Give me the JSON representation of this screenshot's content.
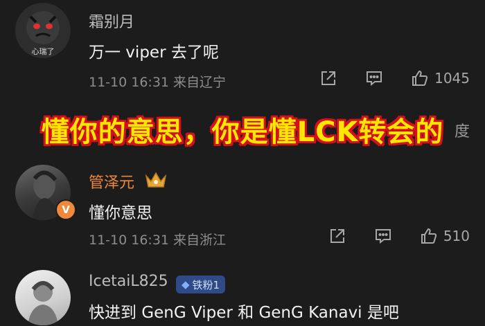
{
  "comments": [
    {
      "username": "霜别月",
      "avatar_text": "心瑞了",
      "text": "万一 viper 去了呢",
      "meta": "11-10 16:31  来自辽宁",
      "likes": "1045"
    },
    {
      "username": "管泽元",
      "vip_mark": "V",
      "text": "懂你意思",
      "meta": "11-10 16:31  来自浙江",
      "likes": "510"
    },
    {
      "username": "IcetaiL825",
      "fan_badge": "铁粉1",
      "text": "快进到 GenG Viper 和 GenG Kanavi 是吧"
    }
  ],
  "overlay": {
    "caption": "懂你的意思，你是懂LCK转会的",
    "edge_char": "度"
  },
  "icons": [
    "share-icon",
    "reply-icon",
    "like-icon",
    "crown-badge-icon",
    "vip-badge-icon",
    "diamond-icon"
  ],
  "colors": {
    "background": "#1c1c1c",
    "username_highlight": "#f0883c",
    "caption_fill": "#ffe600",
    "caption_outline": "#d4101a"
  }
}
